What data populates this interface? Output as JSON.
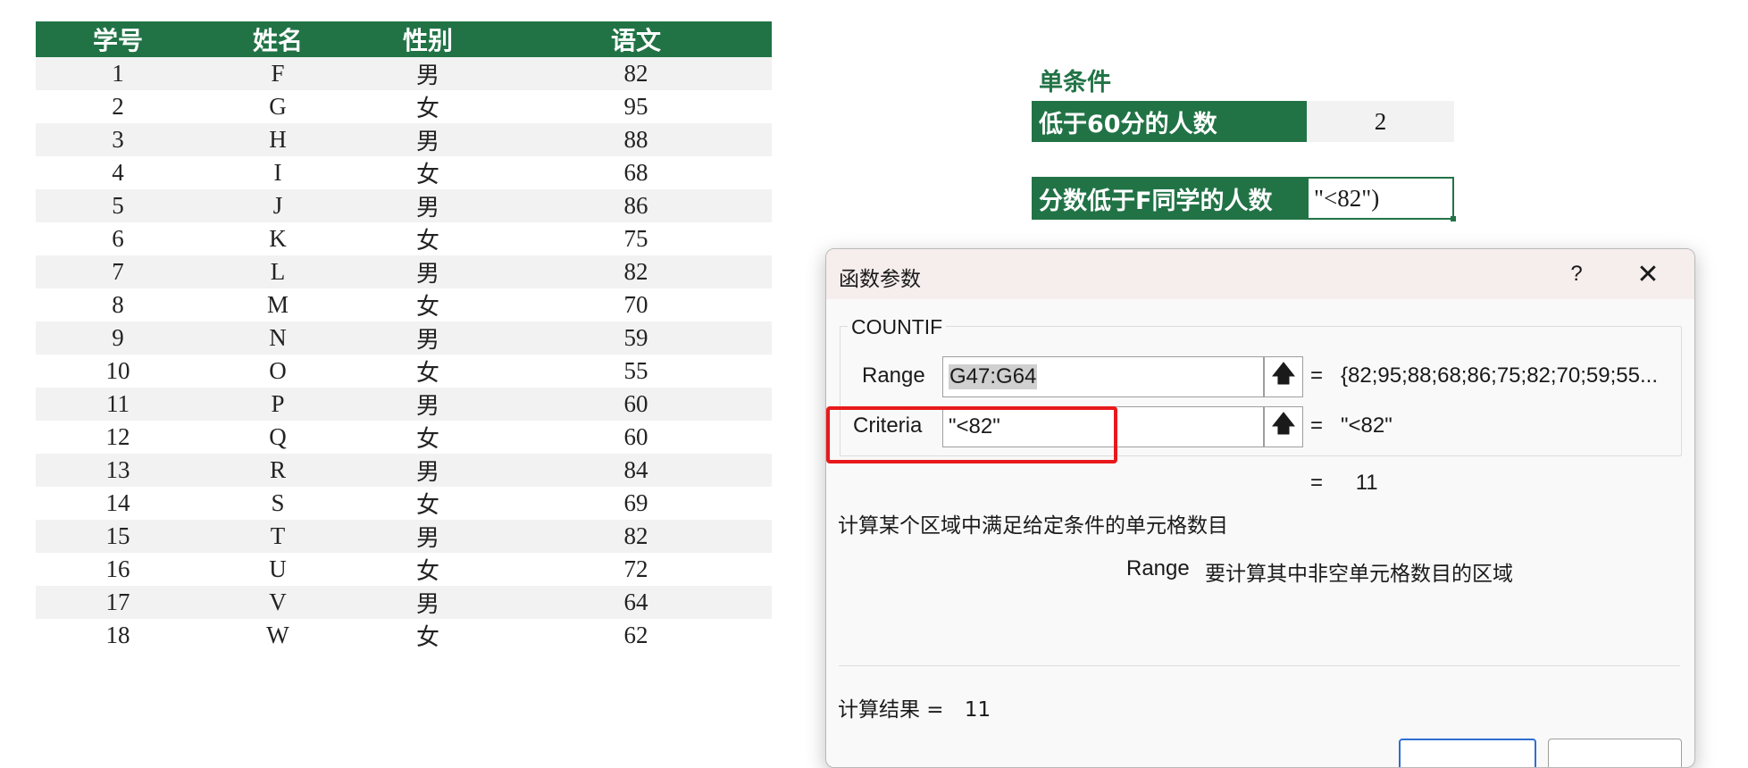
{
  "table": {
    "headers": [
      "学号",
      "姓名",
      "性别",
      "语文"
    ],
    "rows": [
      [
        "1",
        "F",
        "男",
        "82"
      ],
      [
        "2",
        "G",
        "女",
        "95"
      ],
      [
        "3",
        "H",
        "男",
        "88"
      ],
      [
        "4",
        "I",
        "女",
        "68"
      ],
      [
        "5",
        "J",
        "男",
        "86"
      ],
      [
        "6",
        "K",
        "女",
        "75"
      ],
      [
        "7",
        "L",
        "男",
        "82"
      ],
      [
        "8",
        "M",
        "女",
        "70"
      ],
      [
        "9",
        "N",
        "男",
        "59"
      ],
      [
        "10",
        "O",
        "女",
        "55"
      ],
      [
        "11",
        "P",
        "男",
        "60"
      ],
      [
        "12",
        "Q",
        "女",
        "60"
      ],
      [
        "13",
        "R",
        "男",
        "84"
      ],
      [
        "14",
        "S",
        "女",
        "69"
      ],
      [
        "15",
        "T",
        "男",
        "82"
      ],
      [
        "16",
        "U",
        "女",
        "72"
      ],
      [
        "17",
        "V",
        "男",
        "64"
      ],
      [
        "18",
        "W",
        "女",
        "62"
      ]
    ]
  },
  "summary": {
    "title": "单条件",
    "below60_label": "低于60分的人数",
    "below60_value": "2",
    "belowF_label": "分数低于F同学的人数",
    "belowF_value": "\"<82\")"
  },
  "dialog": {
    "title": "函数参数",
    "help": "?",
    "close": "✕",
    "function_name": "COUNTIF",
    "range_label": "Range",
    "range_value": "G47:G64",
    "range_result": "{82;95;88;68;86;75;82;70;59;55...",
    "criteria_label": "Criteria",
    "criteria_value": "\"<82\"",
    "criteria_result": "\"<82\"",
    "equals": "=",
    "formula_result": "11",
    "description": "计算某个区域中满足给定条件的单元格数目",
    "arg_name": "Range",
    "arg_description": "要计算其中非空单元格数目的区域",
    "result_label": "计算结果 =",
    "result_value": "11",
    "collapse_icon": "🡅"
  },
  "colors": {
    "excel_green": "#217346",
    "highlight_red": "#e8191b",
    "band_gray": "#f2f2f2"
  }
}
